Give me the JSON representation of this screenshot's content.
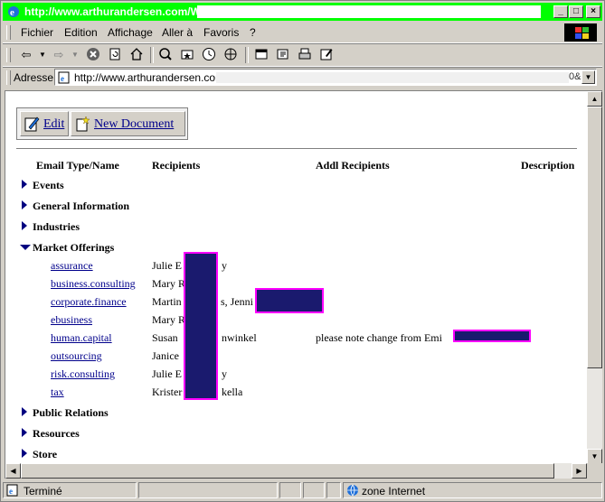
{
  "window": {
    "title": "http://www.arthurandersen.com/W",
    "minimize": "_",
    "maximize": "□",
    "close": "×"
  },
  "menu": [
    {
      "label": "Fichier"
    },
    {
      "label": "Edition"
    },
    {
      "label": "Affichage"
    },
    {
      "label": "Aller à"
    },
    {
      "label": "Favoris"
    },
    {
      "label": "?"
    }
  ],
  "address": {
    "label": "Adresse",
    "url": "http://www.arthurandersen.com/W",
    "tail": "0&"
  },
  "buttons": {
    "edit": "Edit",
    "new_document": "New Document"
  },
  "table": {
    "headers": [
      "Email Type/Name",
      "Recipients",
      "Addl Recipients",
      "Description"
    ]
  },
  "categories": [
    {
      "label": "Events",
      "expanded": false
    },
    {
      "label": "General Information",
      "expanded": false
    },
    {
      "label": "Industries",
      "expanded": false
    },
    {
      "label": "Market Offerings",
      "expanded": true
    },
    {
      "label": "Public Relations",
      "expanded": false
    },
    {
      "label": "Resources",
      "expanded": false
    },
    {
      "label": "Store",
      "expanded": false
    }
  ],
  "market_offerings": [
    {
      "name": "assurance",
      "recipients": "Julie E",
      "recipients_tail": "y",
      "addl": ""
    },
    {
      "name": "business.consulting",
      "recipients": "Mary R",
      "recipients_tail": "",
      "addl": ""
    },
    {
      "name": "corporate.finance",
      "recipients": "Martin",
      "recipients_tail": "s, Jenni",
      "addl": ""
    },
    {
      "name": "ebusiness",
      "recipients": "Mary R",
      "recipients_tail": "",
      "addl": ""
    },
    {
      "name": "human.capital",
      "recipients": "Susan",
      "recipients_tail": "nwinkel",
      "addl": "please note change from Emi"
    },
    {
      "name": "outsourcing",
      "recipients": "Janice",
      "recipients_tail": "",
      "addl": ""
    },
    {
      "name": "risk.consulting",
      "recipients": "Julie E",
      "recipients_tail": "y",
      "addl": ""
    },
    {
      "name": "tax",
      "recipients": "Krister",
      "recipients_tail": "kella",
      "addl": ""
    }
  ],
  "status": {
    "left": "Terminé",
    "zone": "zone Internet"
  }
}
